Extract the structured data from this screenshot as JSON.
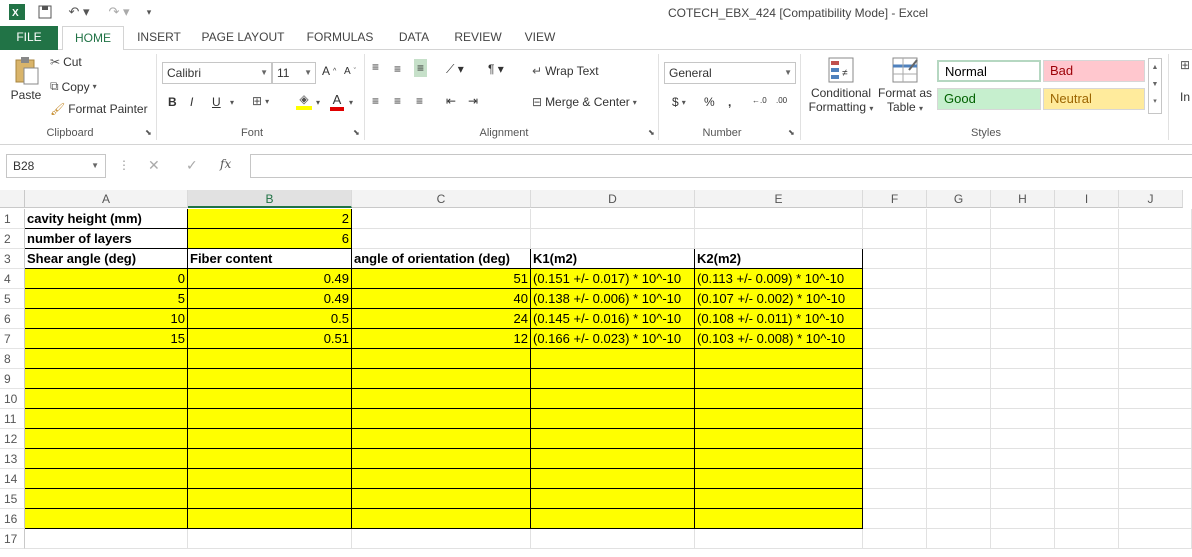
{
  "window": {
    "title": "COTECH_EBX_424  [Compatibility Mode] - Excel"
  },
  "qat": {
    "icons": [
      "excel-logo-icon",
      "save-icon",
      "undo-icon",
      "redo-icon",
      "customize-icon"
    ]
  },
  "tabs": [
    "FILE",
    "HOME",
    "INSERT",
    "PAGE LAYOUT",
    "FORMULAS",
    "DATA",
    "REVIEW",
    "VIEW"
  ],
  "ribbon": {
    "clipboard": {
      "paste": "Paste",
      "cut": "Cut",
      "copy": "Copy",
      "format_painter": "Format Painter",
      "label": "Clipboard"
    },
    "font": {
      "name": "Calibri",
      "size": "11",
      "bold": "B",
      "italic": "I",
      "underline": "U",
      "label": "Font"
    },
    "alignment": {
      "wrap_text": "Wrap Text",
      "merge_center": "Merge & Center",
      "label": "Alignment"
    },
    "number": {
      "format": "General",
      "currency": "$",
      "percent": "%",
      "comma": ",",
      "label": "Number"
    },
    "styles": {
      "conditional": "Conditional",
      "conditional2": "Formatting",
      "format_as": "Format as",
      "format_as2": "Table",
      "normal": "Normal",
      "bad": "Bad",
      "good": "Good",
      "neutral": "Neutral",
      "label": "Styles"
    },
    "cells_partial": "In",
    "colors": {
      "accent": "#217346",
      "bad_bg": "#ffc7ce",
      "good_bg": "#c6efce",
      "neutral_bg": "#ffeb9c"
    }
  },
  "formula_bar": {
    "name_box": "B28",
    "fx": "fx",
    "value": ""
  },
  "columns": [
    "A",
    "B",
    "C",
    "D",
    "E",
    "F",
    "G",
    "H",
    "I",
    "J"
  ],
  "selected_column": "B",
  "rows": [
    [
      "cavity height (mm)",
      "2",
      "",
      "",
      ""
    ],
    [
      "number of layers",
      "6",
      "",
      "",
      ""
    ],
    [
      "Shear angle (deg)",
      "Fiber content",
      "angle of orientation (deg)",
      "K1(m2)",
      "K2(m2)"
    ],
    [
      "0",
      "0.49",
      "51",
      "(0.151 +/- 0.017) * 10^-10",
      "(0.113 +/- 0.009) * 10^-10"
    ],
    [
      "5",
      "0.49",
      "40",
      "(0.138 +/- 0.006) * 10^-10",
      "(0.107 +/- 0.002) * 10^-10"
    ],
    [
      "10",
      "0.5",
      "24",
      "(0.145 +/- 0.016) * 10^-10",
      "(0.108 +/- 0.011) * 10^-10"
    ],
    [
      "15",
      "0.51",
      "12",
      "(0.166 +/- 0.023) * 10^-10",
      "(0.103 +/- 0.008) * 10^-10"
    ]
  ],
  "row_numbers": [
    "1",
    "2",
    "3",
    "4",
    "5",
    "6",
    "7",
    "8",
    "9",
    "10",
    "11",
    "12",
    "13",
    "14",
    "15",
    "16",
    "17"
  ]
}
